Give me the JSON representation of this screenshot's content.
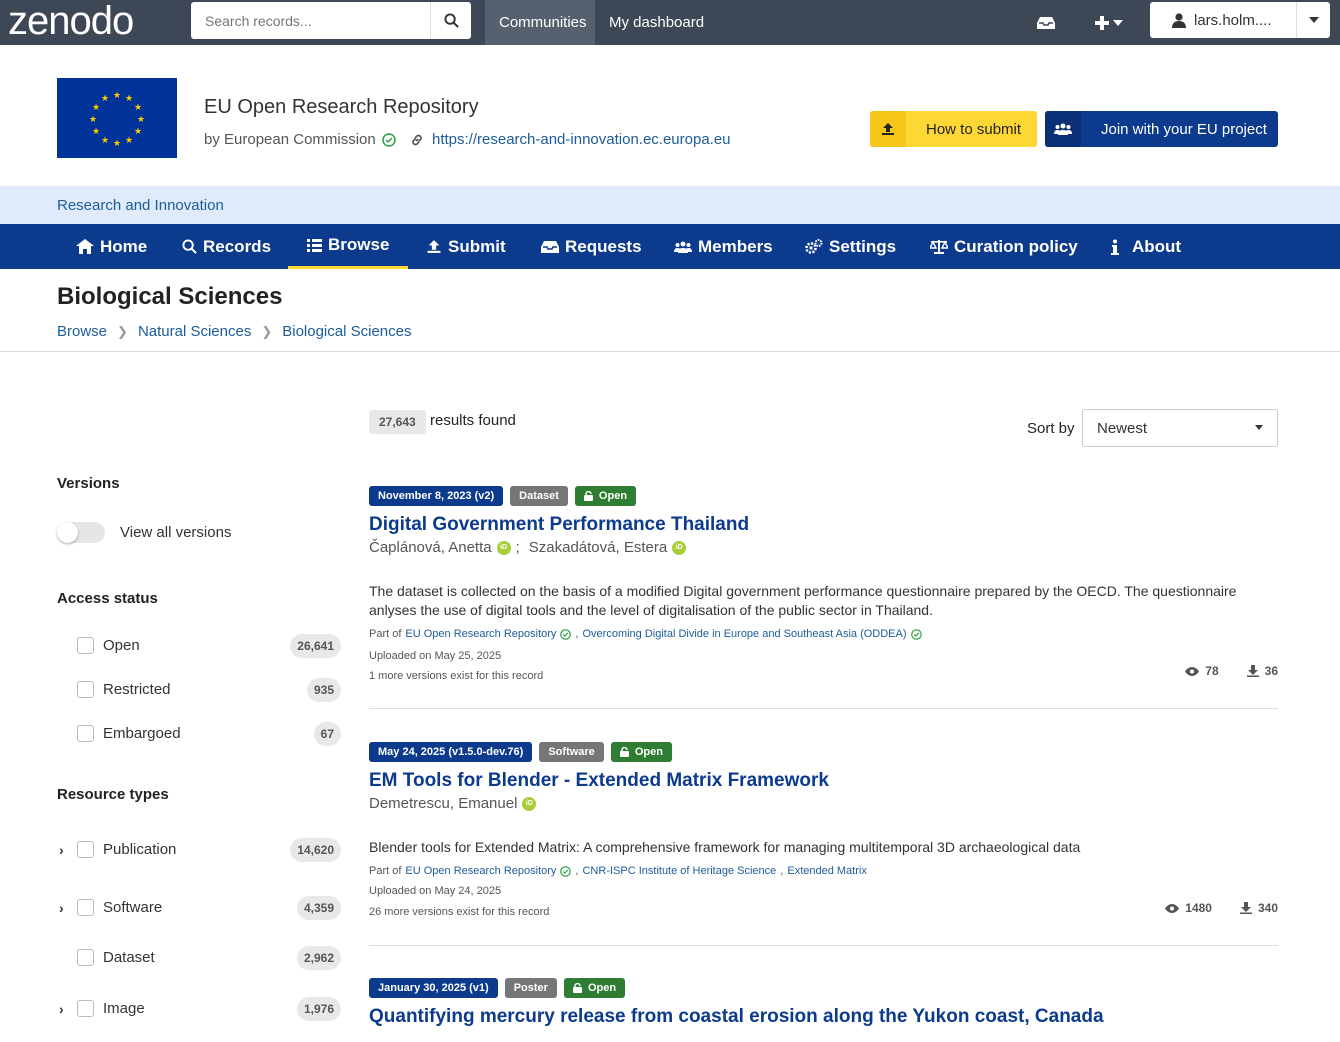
{
  "topbar": {
    "logo": "zenodo",
    "search_placeholder": "Search records...",
    "nav": [
      "Communities",
      "My dashboard"
    ],
    "user": "lars.holm...."
  },
  "community": {
    "title": "EU Open Research Repository",
    "by": "by European Commission",
    "url": "https://research-and-innovation.ec.europa.eu",
    "btn_submit": "How to submit",
    "btn_join": "Join with your EU project",
    "subband": "Research and Innovation"
  },
  "mainnav": [
    {
      "label": "Home",
      "icon": "home-icon"
    },
    {
      "label": "Records",
      "icon": "search-icon"
    },
    {
      "label": "Browse",
      "icon": "list-icon"
    },
    {
      "label": "Submit",
      "icon": "upload-icon"
    },
    {
      "label": "Requests",
      "icon": "inbox-icon"
    },
    {
      "label": "Members",
      "icon": "users-icon"
    },
    {
      "label": "Settings",
      "icon": "cogs-icon"
    },
    {
      "label": "Curation policy",
      "icon": "balance-icon"
    },
    {
      "label": "About",
      "icon": "info-icon"
    }
  ],
  "page": {
    "title": "Biological Sciences",
    "breadcrumb": [
      "Browse",
      "Natural Sciences",
      "Biological Sciences"
    ]
  },
  "filters": {
    "versions": {
      "title": "Versions",
      "toggle_label": "View all versions"
    },
    "access": {
      "title": "Access status",
      "items": [
        {
          "label": "Open",
          "count": "26,641"
        },
        {
          "label": "Restricted",
          "count": "935"
        },
        {
          "label": "Embargoed",
          "count": "67"
        }
      ]
    },
    "types": {
      "title": "Resource types",
      "items": [
        {
          "label": "Publication",
          "count": "14,620"
        },
        {
          "label": "Software",
          "count": "4,359"
        },
        {
          "label": "Dataset",
          "count": "2,962"
        },
        {
          "label": "Image",
          "count": "1,976"
        }
      ]
    }
  },
  "results": {
    "count": "27,643",
    "count_text": "results found",
    "sort_label": "Sort by",
    "sort_value": "Newest"
  },
  "records": [
    {
      "date": "November 8, 2023 (v2)",
      "type": "Dataset",
      "access": "Open",
      "title": "Digital Government Performance Thailand",
      "authors": [
        "Čaplánová, Anetta",
        "Szakadátová, Estera"
      ],
      "description": "The dataset is collected on the basis of a modified Digital government performance questionnaire prepared by the OECD. The questionnaire anlyses the use of digital tools and the level of digitalisation of the public sector in Thailand.",
      "part_of_label": "Part of",
      "communities": [
        "EU Open Research Repository",
        "Overcoming Digital Divide in Europe and Southeast Asia (ODDEA)"
      ],
      "uploaded": "Uploaded on May 25, 2025",
      "versions": "1 more versions exist for this record",
      "views": "78",
      "downloads": "36"
    },
    {
      "date": "May 24, 2025 (v1.5.0-dev.76)",
      "type": "Software",
      "access": "Open",
      "title": "EM Tools for Blender - Extended Matrix Framework",
      "authors": [
        "Demetrescu, Emanuel"
      ],
      "description": "Blender tools for Extended Matrix: A comprehensive framework for managing multitemporal 3D archaeological data",
      "part_of_label": "Part of",
      "communities": [
        "EU Open Research Repository",
        "CNR-ISPC Institute of Heritage Science",
        "Extended Matrix"
      ],
      "uploaded": "Uploaded on May 24, 2025",
      "versions": "26 more versions exist for this record",
      "views": "1480",
      "downloads": "340"
    },
    {
      "date": "January 30, 2025 (v1)",
      "type": "Poster",
      "access": "Open",
      "title": "Quantifying mercury release from coastal erosion along the Yukon coast, Canada"
    }
  ]
}
